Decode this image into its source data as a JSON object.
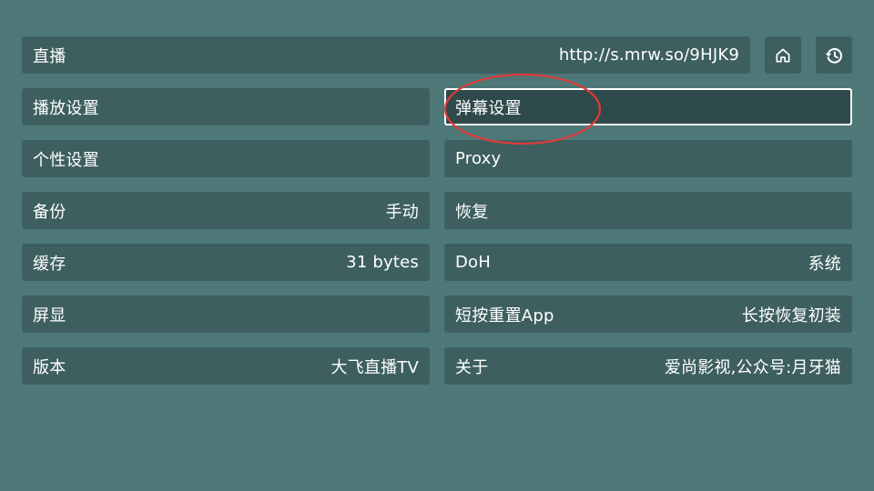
{
  "live": {
    "label": "直播",
    "value": "http://s.mrw.so/9HJK9"
  },
  "icons": {
    "home": "home-icon",
    "history": "history-icon"
  },
  "settings": {
    "left": [
      {
        "label": "播放设置",
        "value": ""
      },
      {
        "label": "个性设置",
        "value": ""
      },
      {
        "label": "备份",
        "value": "手动"
      },
      {
        "label": "缓存",
        "value": "31 bytes"
      },
      {
        "label": "屏显",
        "value": ""
      },
      {
        "label": "版本",
        "value": "大飞直播TV"
      }
    ],
    "right": [
      {
        "label": "弹幕设置",
        "value": ""
      },
      {
        "label": "Proxy",
        "value": ""
      },
      {
        "label": "恢复",
        "value": ""
      },
      {
        "label": "DoH",
        "value": "系统"
      },
      {
        "label": "短按重置App",
        "value": "长按恢复初装"
      },
      {
        "label": "关于",
        "value": "爱尚影视,公众号:月牙猫"
      }
    ]
  },
  "focused_item": "弹幕设置",
  "colors": {
    "background": "#4e7878",
    "item_background": "#3e5f5f",
    "focused_background": "#2f4a4a",
    "focus_border": "#ffffff",
    "annotation": "#e03a3a"
  }
}
